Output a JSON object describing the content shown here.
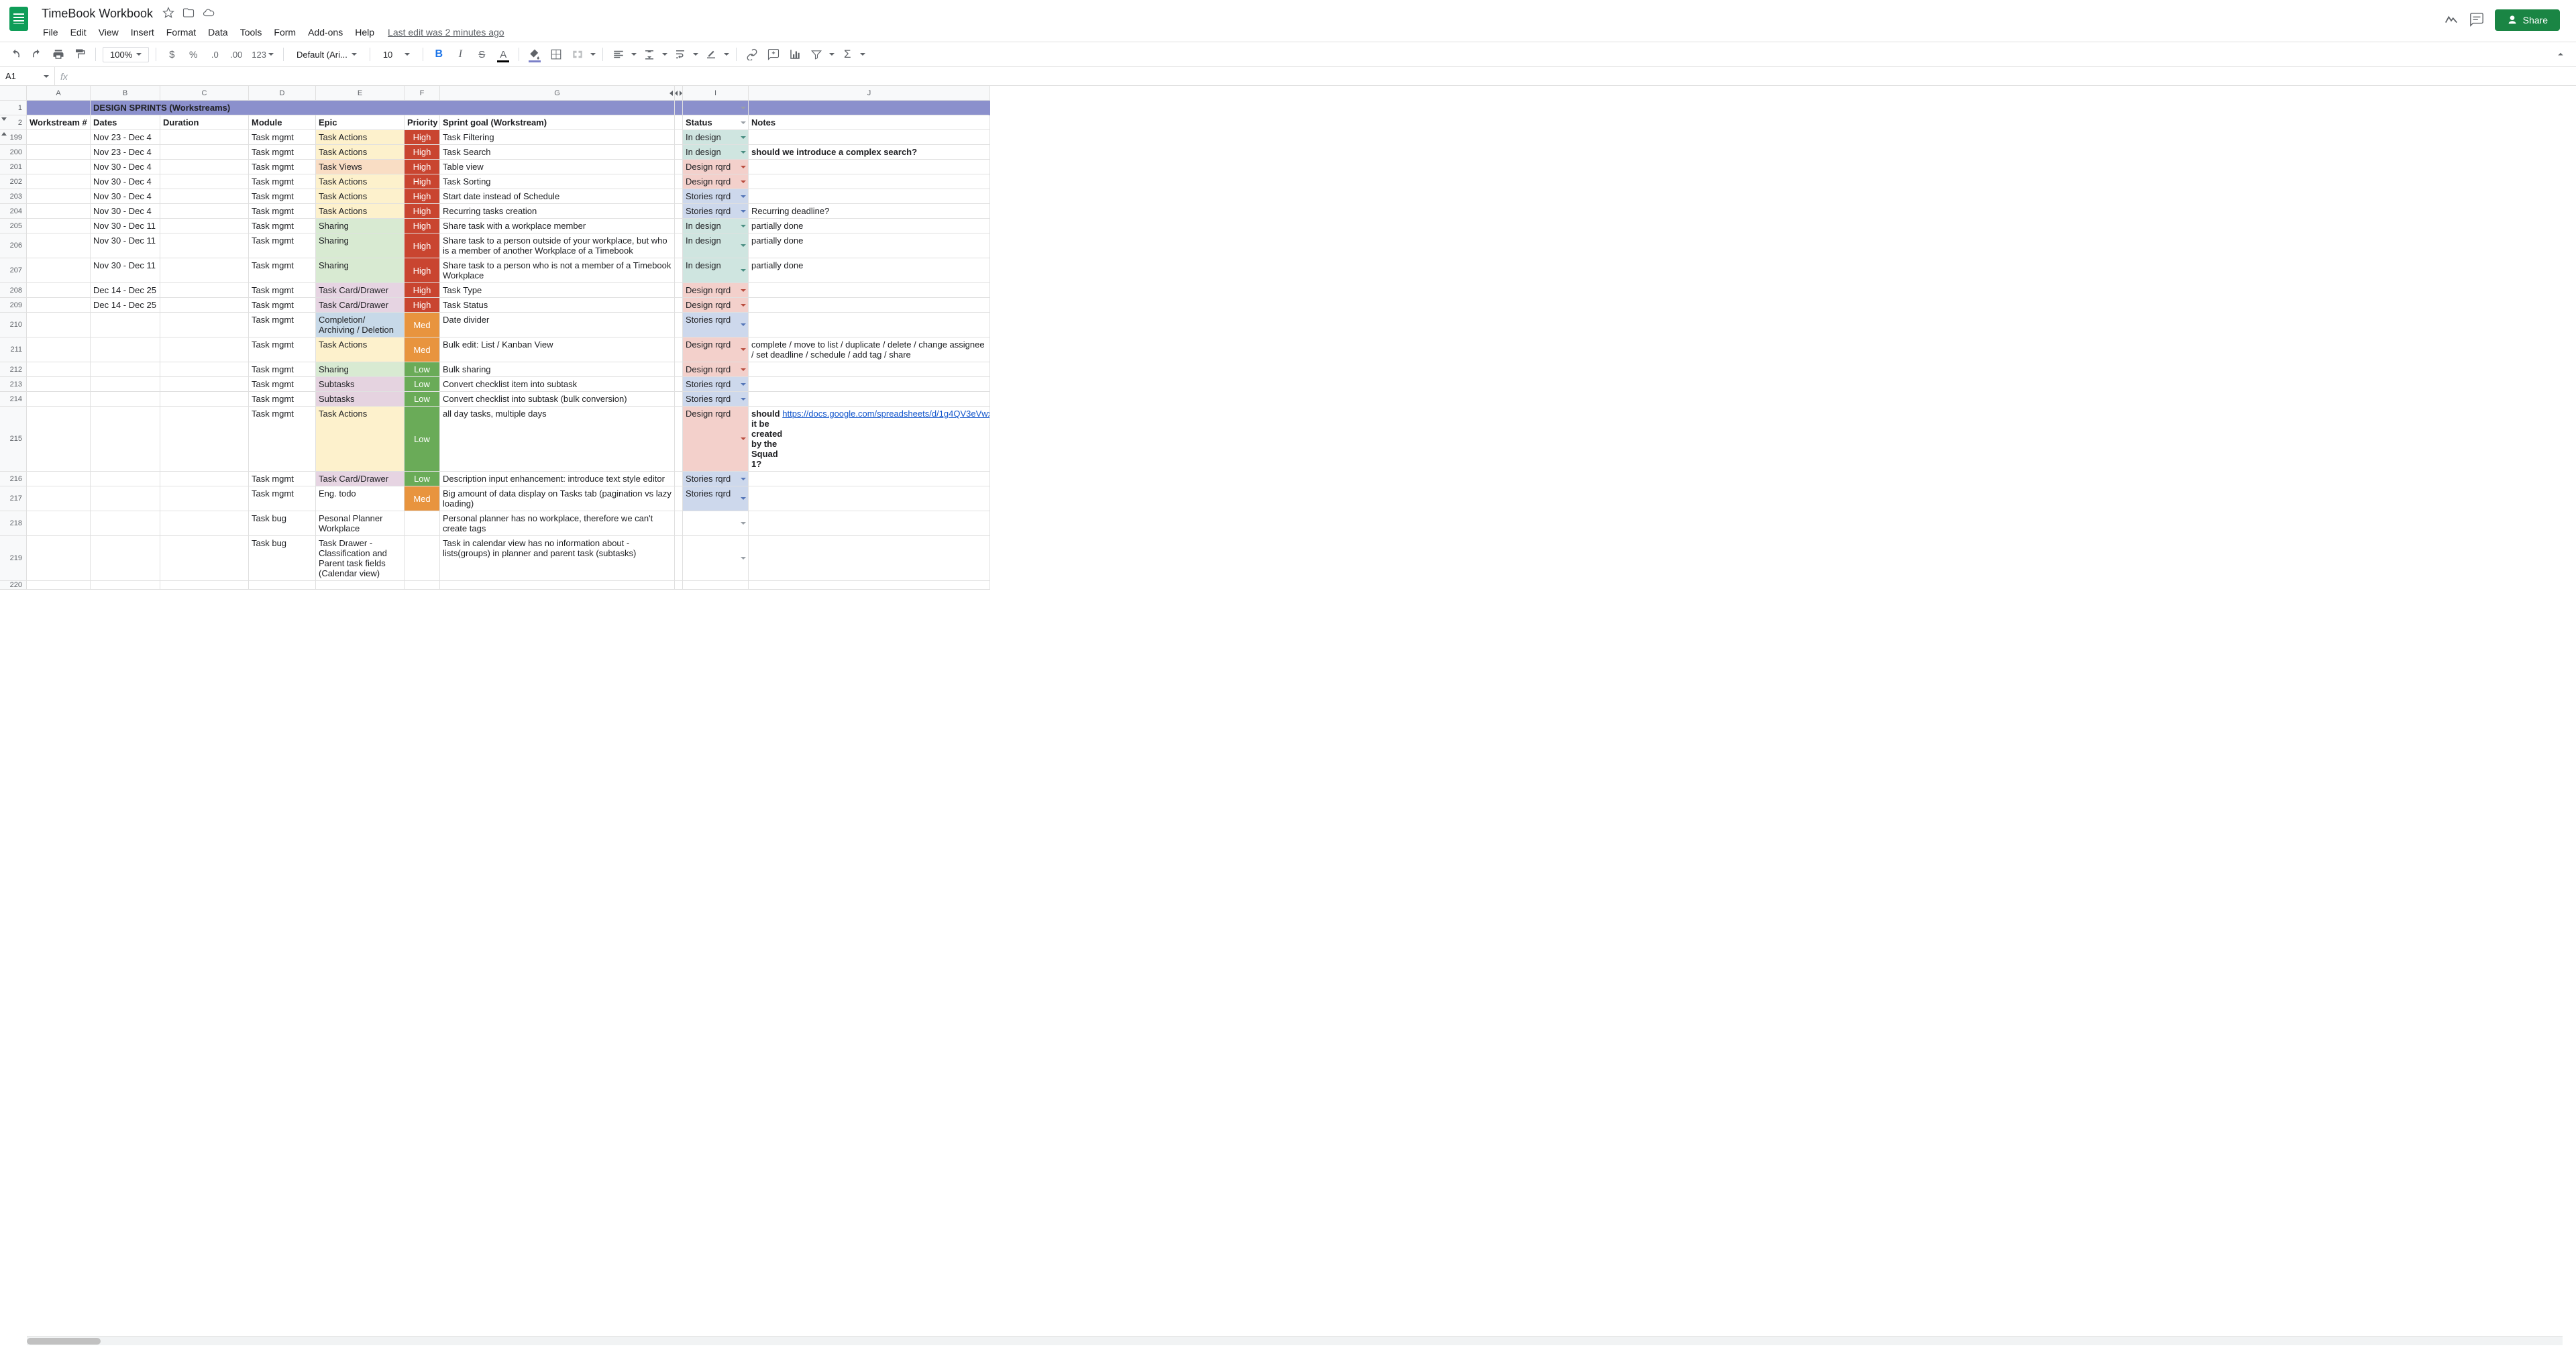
{
  "doc": {
    "title": "TimeBook Workbook",
    "last_edit": "Last edit was 2 minutes ago"
  },
  "menu": [
    "File",
    "Edit",
    "View",
    "Insert",
    "Format",
    "Data",
    "Tools",
    "Form",
    "Add-ons",
    "Help"
  ],
  "share": "Share",
  "toolbar": {
    "zoom": "100%",
    "font": "Default (Ari...",
    "font_size": "10"
  },
  "namebox": "A1",
  "columns": [
    "A",
    "B",
    "C",
    "D",
    "E",
    "F",
    "G",
    "I",
    "J"
  ],
  "banner": "DESIGN  SPRINTS (Workstreams)",
  "headers": {
    "a": "Workstream #",
    "b": "Dates",
    "c": "Duration",
    "d": "Module",
    "e": "Epic",
    "f": "Priority",
    "g": "Sprint goal (Workstream)",
    "i": "Status",
    "j": "Notes"
  },
  "row_numbers": [
    "1",
    "2",
    "199",
    "200",
    "201",
    "202",
    "203",
    "204",
    "205",
    "206",
    "207",
    "208",
    "209",
    "210",
    "211",
    "212",
    "213",
    "214",
    "215",
    "216",
    "217",
    "218",
    "219",
    "220"
  ],
  "rows": [
    {
      "b": "Nov 23 - Dec 4",
      "d": "Task mgmt",
      "e": "Task Actions",
      "ec": "epic-taskactions",
      "f": "High",
      "fc": "prio-high",
      "g": "Task Filtering",
      "i": "In design",
      "ic": "status-indesign",
      "cc": "caret-teal",
      "j": ""
    },
    {
      "b": "Nov 23 - Dec 4",
      "d": "Task mgmt",
      "e": "Task Actions",
      "ec": "epic-taskactions",
      "f": "High",
      "fc": "prio-high",
      "g": "Task Search",
      "i": "In design",
      "ic": "status-indesign",
      "cc": "caret-teal",
      "j": "should we introduce a complex search?",
      "jb": true
    },
    {
      "b": "Nov 30 - Dec 4",
      "d": "Task mgmt",
      "e": "Task Views",
      "ec": "epic-taskviews",
      "f": "High",
      "fc": "prio-high",
      "g": "Table view",
      "i": "Design rqrd",
      "ic": "status-designrqrd",
      "cc": "caret-red",
      "j": ""
    },
    {
      "b": "Nov 30 - Dec 4",
      "d": "Task mgmt",
      "e": "Task Actions",
      "ec": "epic-taskactions",
      "f": "High",
      "fc": "prio-high",
      "g": "Task Sorting",
      "i": "Design rqrd",
      "ic": "status-designrqrd",
      "cc": "caret-red",
      "j": ""
    },
    {
      "b": "Nov 30 - Dec 4",
      "d": "Task mgmt",
      "e": "Task Actions",
      "ec": "epic-taskactions",
      "f": "High",
      "fc": "prio-high",
      "g": "Start date instead of Schedule",
      "i": "Stories rqrd",
      "ic": "status-storiesrqrd",
      "cc": "caret-blue",
      "j": ""
    },
    {
      "b": "Nov 30 - Dec 4",
      "d": "Task mgmt",
      "e": "Task Actions",
      "ec": "epic-taskactions",
      "f": "High",
      "fc": "prio-high",
      "g": "Recurring tasks creation",
      "i": "Stories rqrd",
      "ic": "status-storiesrqrd",
      "cc": "caret-blue",
      "j": "Recurring deadline?"
    },
    {
      "b": "Nov 30 - Dec 11",
      "d": "Task mgmt",
      "e": "Sharing",
      "ec": "epic-sharing",
      "f": "High",
      "fc": "prio-high",
      "g": "Share task with a workplace member",
      "i": "In design",
      "ic": "status-indesign",
      "cc": "caret-teal",
      "j": "partially done"
    },
    {
      "b": "Nov 30 - Dec 11",
      "d": "Task mgmt",
      "e": "Sharing",
      "ec": "epic-sharing",
      "f": "High",
      "fc": "prio-high",
      "g": "Share task to a person outside of your workplace, but who is a member of another Workplace of a Timebook",
      "i": "In design",
      "ic": "status-indesign",
      "cc": "caret-teal",
      "j": "partially done",
      "h": "tall"
    },
    {
      "b": "Nov 30 - Dec 11",
      "d": "Task mgmt",
      "e": "Sharing",
      "ec": "epic-sharing",
      "f": "High",
      "fc": "prio-high",
      "g": "Share task to a person who is not a member of a Timebook Workplace",
      "i": "In design",
      "ic": "status-indesign",
      "cc": "caret-teal",
      "j": "partially done",
      "h": "tall"
    },
    {
      "b": "Dec 14 - Dec 25",
      "d": "Task mgmt",
      "e": "Task Card/Drawer",
      "ec": "epic-carddrawer",
      "f": "High",
      "fc": "prio-high",
      "g": "Task Type",
      "i": "Design rqrd",
      "ic": "status-designrqrd",
      "cc": "caret-red",
      "j": ""
    },
    {
      "b": "Dec 14 - Dec 25",
      "d": "Task mgmt",
      "e": "Task Card/Drawer",
      "ec": "epic-carddrawer",
      "f": "High",
      "fc": "prio-high",
      "g": "Task Status",
      "i": "Design rqrd",
      "ic": "status-designrqrd",
      "cc": "caret-red",
      "j": ""
    },
    {
      "b": "",
      "d": "Task mgmt",
      "e": "Completion/ Archiving / Deletion",
      "ec": "epic-completion",
      "f": "Med",
      "fc": "prio-med",
      "g": "Date divider",
      "i": "Stories rqrd",
      "ic": "status-storiesrqrd",
      "cc": "caret-blue",
      "j": "",
      "h": "tall"
    },
    {
      "b": "",
      "d": "Task mgmt",
      "e": "Task Actions",
      "ec": "epic-taskactions",
      "f": "Med",
      "fc": "prio-med",
      "g": "Bulk edit: List / Kanban View",
      "i": "Design rqrd",
      "ic": "status-designrqrd",
      "cc": "caret-red",
      "j": "complete / move to list / duplicate / delete / change assignee / set deadline / schedule / add tag / share",
      "h": "tall"
    },
    {
      "b": "",
      "d": "Task mgmt",
      "e": "Sharing",
      "ec": "epic-sharing",
      "f": "Low",
      "fc": "prio-low",
      "g": "Bulk sharing",
      "i": "Design rqrd",
      "ic": "status-designrqrd",
      "cc": "caret-red",
      "j": ""
    },
    {
      "b": "",
      "d": "Task mgmt",
      "e": "Subtasks",
      "ec": "epic-subtasks",
      "f": "Low",
      "fc": "prio-low",
      "g": "Convert checklist item into subtask",
      "i": "Stories rqrd",
      "ic": "status-storiesrqrd",
      "cc": "caret-blue",
      "j": ""
    },
    {
      "b": "",
      "d": "Task mgmt",
      "e": "Subtasks",
      "ec": "epic-subtasks",
      "f": "Low",
      "fc": "prio-low",
      "g": "Convert checklist into subtask (bulk conversion)",
      "i": "Stories rqrd",
      "ic": "status-storiesrqrd",
      "cc": "caret-blue",
      "j": ""
    },
    {
      "b": "",
      "d": "Task mgmt",
      "e": "Task Actions",
      "ec": "epic-taskactions",
      "f": "Low",
      "fc": "prio-low",
      "g": "all day tasks,  multiple days",
      "i": "Design rqrd",
      "ic": "status-designrqrd",
      "cc": "caret-red",
      "j": "should it be created by the Squad 1?",
      "jb": true,
      "jl": "https://docs.google.com/spreadsheets/d/1g4QV3eVwxgdqewsYiM76sUanPejqy7tphJSB9N9rU9M/edit#gid=747249953&range=242:242",
      "h": "tallest"
    },
    {
      "b": "",
      "d": "Task mgmt",
      "e": "Task Card/Drawer",
      "ec": "epic-carddrawer",
      "f": "Low",
      "fc": "prio-low",
      "g": "Description input enhancement: introduce text style editor",
      "i": "Stories rqrd",
      "ic": "status-storiesrqrd",
      "cc": "caret-blue",
      "j": ""
    },
    {
      "b": "",
      "d": "Task mgmt",
      "e": "Eng. todo",
      "ec": "epic-engtodo",
      "f": "Med",
      "fc": "prio-med",
      "g": "Big amount of data display on Tasks tab (pagination vs lazy loading)",
      "i": "Stories rqrd",
      "ic": "status-storiesrqrd",
      "cc": "caret-blue",
      "j": "",
      "h": "tall"
    },
    {
      "b": "",
      "d": "Task bug",
      "e": "Pesonal Planner Workplace",
      "ec": "",
      "f": "",
      "fc": "",
      "g": "Personal planner has no workplace, therefore we can't create tags",
      "i": "",
      "ic": "",
      "cc": "caret-grey",
      "j": "",
      "h": "tall"
    },
    {
      "b": "",
      "d": "Task bug",
      "e": "Task Drawer - Classification and Parent task fields (Calendar view)",
      "ec": "",
      "f": "",
      "fc": "",
      "g": "Task in calendar view has no information about  - lists(groups) in planner and parent task (subtasks)",
      "i": "",
      "ic": "",
      "cc": "caret-grey",
      "j": "",
      "h": "tallest"
    },
    {
      "b": "",
      "d": "",
      "e": "",
      "ec": "",
      "f": "",
      "fc": "",
      "g": "",
      "i": "",
      "ic": "",
      "cc": "",
      "j": ""
    }
  ]
}
